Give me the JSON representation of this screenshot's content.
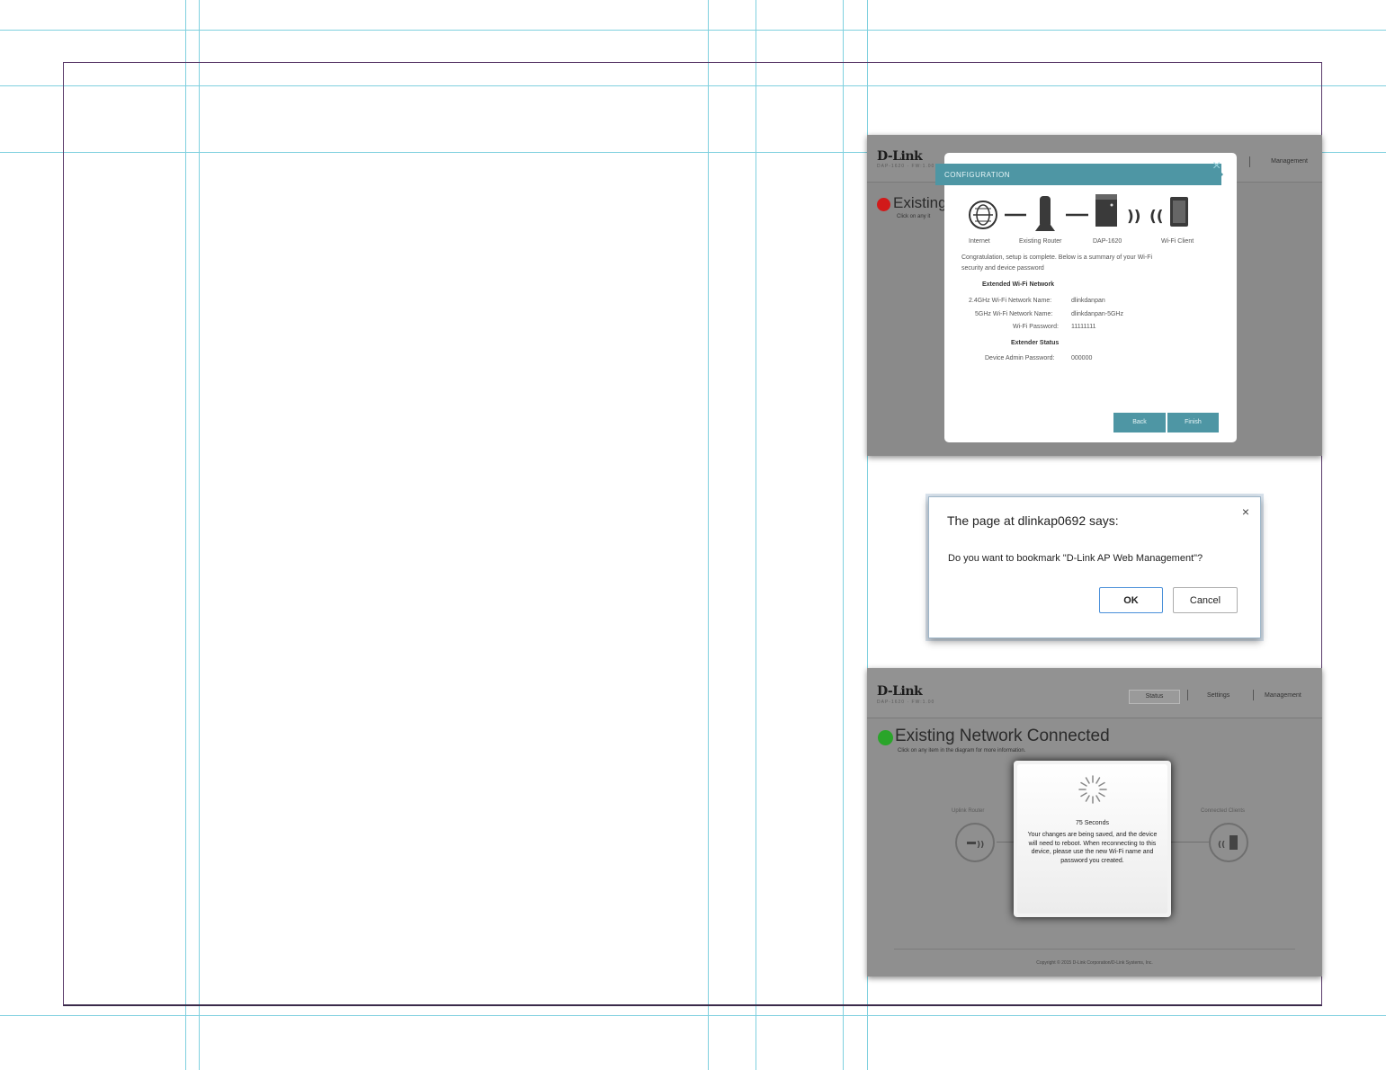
{
  "shot1": {
    "logo": "D-Link",
    "logo_sub": "DAP-1620 · FW:1.00",
    "nav_right": "Management",
    "status_title": "Existing",
    "status_sub": "Click on any it",
    "modal": {
      "title": "CONFIGURATION",
      "close": "×",
      "diagram_labels": [
        "Internet",
        "Existing Router",
        "DAP-1620",
        "Wi-Fi Client"
      ],
      "intro_line1": "Congratulation, setup is complete. Below is a summary of your Wi-Fi",
      "intro_line2": "security and device password",
      "section1_heading": "Extended Wi-Fi Network",
      "net24_label": "2.4GHz Wi-Fi Network Name:",
      "net24_value": "dlinkdanpan",
      "net5_label": "5GHz Wi-Fi Network Name:",
      "net5_value": "dlinkdanpan-5GHz",
      "wifi_pw_label": "Wi-Fi Password:",
      "wifi_pw_value": "11111111",
      "section2_heading": "Extender Status",
      "admin_pw_label": "Device Admin Password:",
      "admin_pw_value": "000000",
      "back_label": "Back",
      "finish_label": "Finish"
    },
    "accent_color": "#4e96a4",
    "status_color": "#d11a1a"
  },
  "dialog": {
    "title": "The page at dlinkap0692 says:",
    "close": "×",
    "message": "Do you want to bookmark \"D-Link AP Web Management\"?",
    "ok_label": "OK",
    "cancel_label": "Cancel"
  },
  "shot3": {
    "logo": "D-Link",
    "logo_sub": "DAP-1620 · FW:1.00",
    "nav": {
      "status": "Status",
      "settings": "Settings",
      "management": "Management"
    },
    "status_title": "Existing Network Connected",
    "status_sub": "Click on any item in the diagram for more information.",
    "left_node_label": "Uplink Router",
    "right_node_label": "Connected Clients",
    "countdown": "75 Seconds",
    "wait_message": "Your changes are being saved, and the device will need to reboot. When reconnecting to this device, please use the new Wi-Fi name and password you created.",
    "copyright": "Copyright © 2015 D-Link Corporation/D-Link Systems, Inc.",
    "status_color": "#2aa52a"
  }
}
